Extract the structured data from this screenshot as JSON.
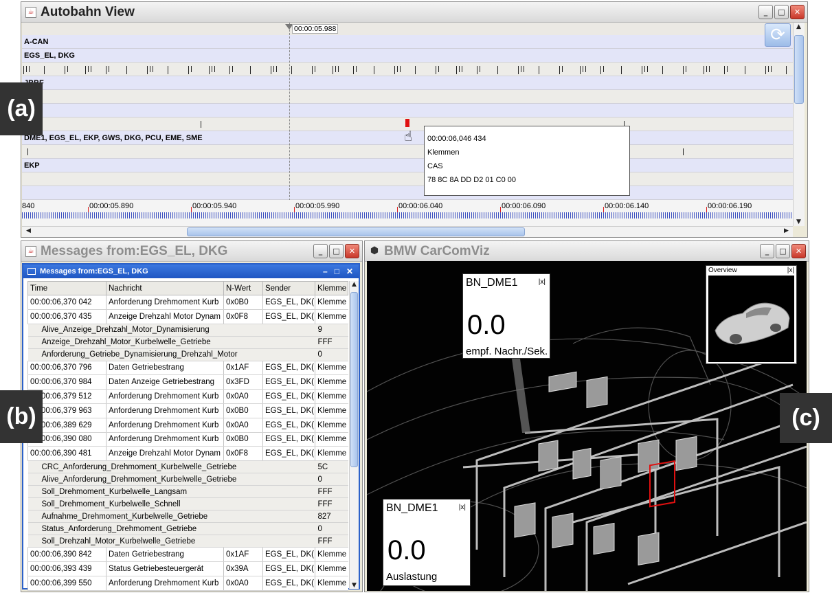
{
  "autobahn": {
    "title": "Autobahn View",
    "cursor_time": "00:00:05.988",
    "lanes": [
      "A-CAN",
      "EGS_EL, DKG",
      "JBBF",
      "DME1, EGS_EL, EKP, GWS, DKG, PCU, EME, SME",
      "EKP"
    ],
    "axis_labels": [
      "840",
      "00:00:05.890",
      "00:00:05.940",
      "00:00:05.990",
      "00:00:06.040",
      "00:00:06.090",
      "00:00:06.140",
      "00:00:06.190"
    ],
    "tooltip": {
      "time": "00:00:06,046 434",
      "name": "Klemmen",
      "sender": "CAS",
      "bytes": "78 8C 8A DD D2 01 C0 00"
    },
    "label": "(a)"
  },
  "messages": {
    "outer_title": "Messages from:EGS_EL, DKG",
    "inner_title": "Messages from:EGS_EL, DKG",
    "columns": [
      "Time",
      "Nachricht",
      "N-Wert",
      "Sender",
      "Klemme"
    ],
    "rows": [
      {
        "kind": "main",
        "cells": [
          "00:00:06,370 042",
          "Anforderung Drehmoment Kurb",
          "0x0B0",
          "EGS_EL, DK(",
          "Klemme"
        ]
      },
      {
        "kind": "main",
        "cells": [
          "00:00:06,370 435",
          "Anzeige Drehzahl Motor Dynam",
          "0x0F8",
          "EGS_EL, DK(",
          "Klemme"
        ]
      },
      {
        "kind": "sig",
        "cells": [
          "Alive_Anzeige_Drehzahl_Motor_Dynamisierung",
          "9"
        ]
      },
      {
        "kind": "sig",
        "cells": [
          "Anzeige_Drehzahl_Motor_Kurbelwelle_Getriebe",
          "FFF"
        ]
      },
      {
        "kind": "sig",
        "cells": [
          "Anforderung_Getriebe_Dynamisierung_Drehzahl_Motor",
          "0"
        ]
      },
      {
        "kind": "main",
        "cells": [
          "00:00:06,370 796",
          "Daten Getriebestrang",
          "0x1AF",
          "EGS_EL, DK(",
          "Klemme"
        ]
      },
      {
        "kind": "main",
        "cells": [
          "00:00:06,370 984",
          "Daten Anzeige Getriebestrang",
          "0x3FD",
          "EGS_EL, DK(",
          "Klemme"
        ]
      },
      {
        "kind": "main",
        "cells": [
          "00:00:06,379 512",
          "Anforderung Drehmoment Kurb",
          "0x0A0",
          "EGS_EL, DK(",
          "Klemme"
        ]
      },
      {
        "kind": "main",
        "cells": [
          "00:00:06,379 963",
          "Anforderung Drehmoment Kurb",
          "0x0B0",
          "EGS_EL, DK(",
          "Klemme"
        ]
      },
      {
        "kind": "main",
        "cells": [
          "00:00:06,389 629",
          "Anforderung Drehmoment Kurb",
          "0x0A0",
          "EGS_EL, DK(",
          "Klemme"
        ]
      },
      {
        "kind": "main",
        "cells": [
          "00:00:06,390 080",
          "Anforderung Drehmoment Kurb",
          "0x0B0",
          "EGS_EL, DK(",
          "Klemme"
        ]
      },
      {
        "kind": "main",
        "cells": [
          "00:00:06,390 481",
          "Anzeige Drehzahl Motor Dynam",
          "0x0F8",
          "EGS_EL, DK(",
          "Klemme"
        ]
      },
      {
        "kind": "sig",
        "cells": [
          "CRC_Anforderung_Drehmoment_Kurbelwelle_Getriebe",
          "5C"
        ]
      },
      {
        "kind": "sig",
        "cells": [
          "Alive_Anforderung_Drehmoment_Kurbelwelle_Getriebe",
          "0"
        ]
      },
      {
        "kind": "sig",
        "cells": [
          "Soll_Drehmoment_Kurbelwelle_Langsam",
          "FFF"
        ]
      },
      {
        "kind": "sig",
        "cells": [
          "Soll_Drehmoment_Kurbelwelle_Schnell",
          "FFF"
        ]
      },
      {
        "kind": "sig",
        "cells": [
          "Aufnahme_Drehmoment_Kurbelwelle_Getriebe",
          "827"
        ]
      },
      {
        "kind": "sig",
        "cells": [
          "Status_Anforderung_Drehmoment_Getriebe",
          "0"
        ]
      },
      {
        "kind": "sig",
        "cells": [
          "Soll_Drehzahl_Motor_Kurbelwelle_Getriebe",
          "FFF"
        ]
      },
      {
        "kind": "main",
        "cells": [
          "00:00:06,390 842",
          "Daten Getriebestrang",
          "0x1AF",
          "EGS_EL, DK(",
          "Klemme"
        ]
      },
      {
        "kind": "main",
        "cells": [
          "00:00:06,393 439",
          "Status Getriebesteuergerät",
          "0x39A",
          "EGS_EL, DK(",
          "Klemme"
        ]
      },
      {
        "kind": "main",
        "cells": [
          "00:00:06,399 550",
          "Anforderung Drehmoment Kurb",
          "0x0A0",
          "EGS_EL, DK(",
          "Klemme"
        ]
      }
    ],
    "label": "(b)"
  },
  "carcomviz": {
    "title": "BMW CarComViz",
    "gauge1": {
      "name": "BN_DME1",
      "close": "|x|",
      "value": "0.0",
      "unit": "empf. Nachr./Sek."
    },
    "gauge2": {
      "name": "BN_DME1",
      "close": "|x|",
      "value": "0.0",
      "unit": "Auslastung"
    },
    "overview": {
      "title": "Overview",
      "close": "|x|"
    },
    "label": "(c)"
  },
  "colors": {
    "accent": "#2b61c9",
    "marker": "#e01010",
    "lane_blue": "#e3e5f8"
  },
  "icons": [
    "java-cup-icon",
    "minimize-icon",
    "maximize-icon",
    "close-icon",
    "refresh-icon",
    "hand-cursor-icon",
    "cube-logo-icon"
  ]
}
